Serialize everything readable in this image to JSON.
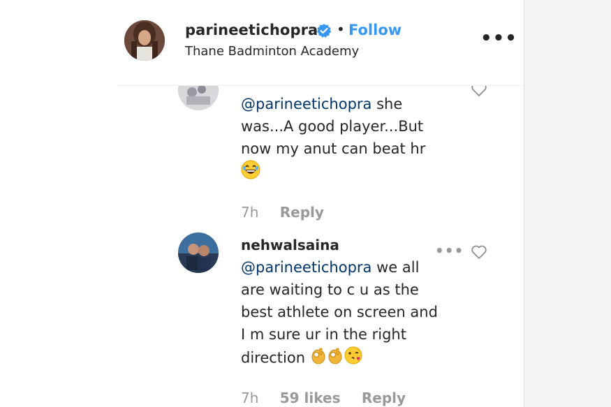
{
  "header": {
    "username": "parineetichopra",
    "separator": "•",
    "follow_label": "Follow",
    "location": "Thane Badminton Academy",
    "more_label": "•••"
  },
  "comments": [
    {
      "mention": "@parineetichopra",
      "text_lines": [
        "she",
        "was...A good player...But",
        "now my anut can beat hr"
      ],
      "emojis": [
        "face-with-tears-of-joy"
      ],
      "time": "7h",
      "reply_label": "Reply"
    },
    {
      "username": "nehwalsaina",
      "mention": "@parineetichopra",
      "text_lines": [
        "we all",
        "are waiting to c u as the",
        "best athlete on screen and",
        "I m sure ur in the right",
        "direction"
      ],
      "emojis": [
        "ok-hand",
        "ok-hand",
        "face-blowing-a-kiss"
      ],
      "time": "7h",
      "likes": "59 likes",
      "reply_label": "Reply",
      "more_label": "•••"
    }
  ],
  "colors": {
    "link": "#3897f0",
    "mention": "#003569",
    "muted": "#999999",
    "text": "#262626",
    "verified": "#3897f0"
  }
}
